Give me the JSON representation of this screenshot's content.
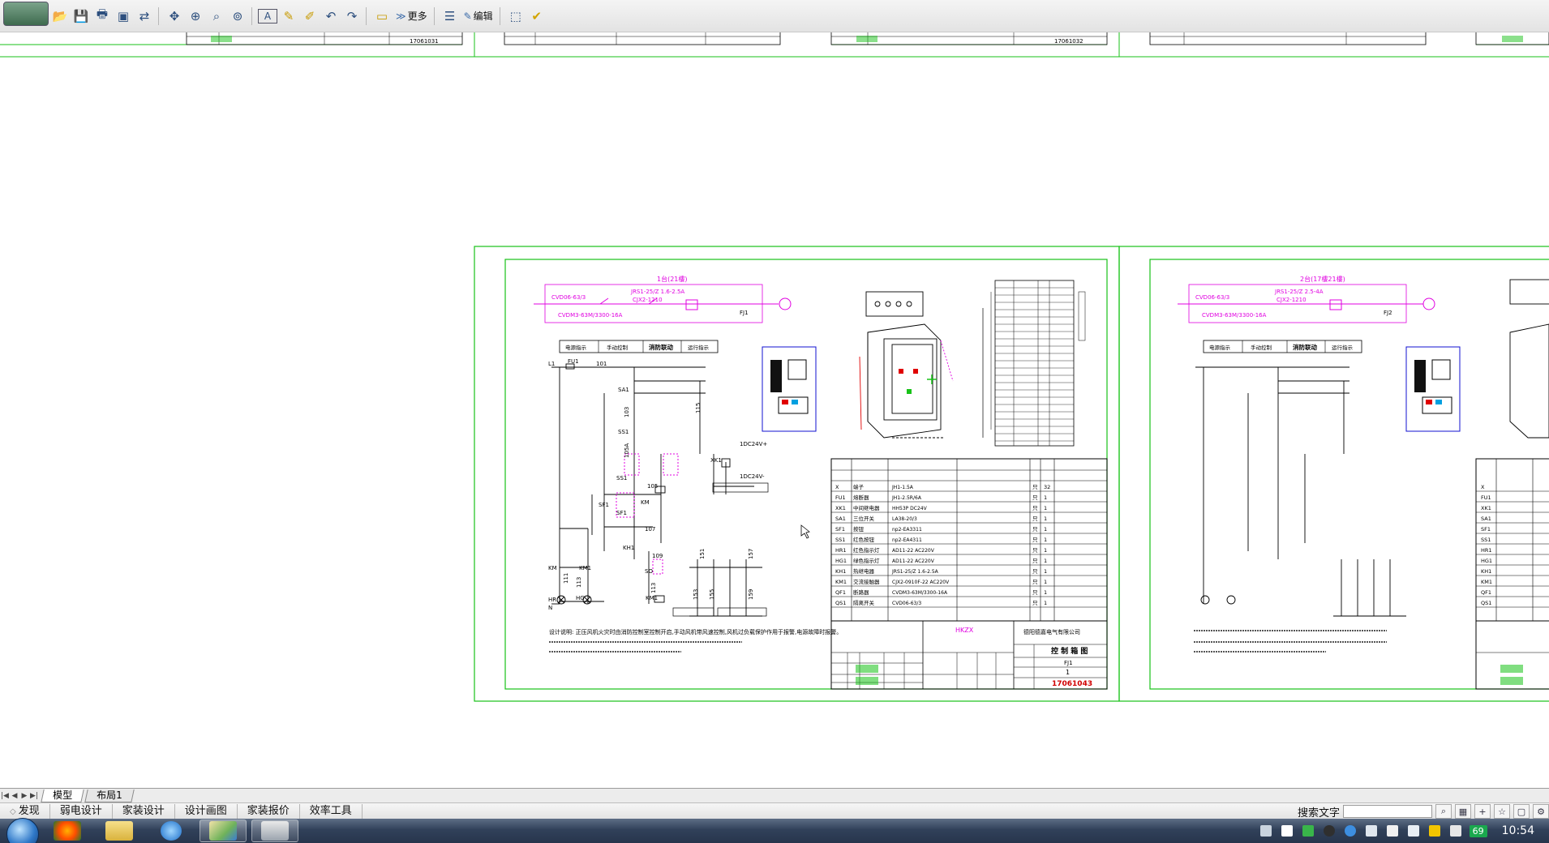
{
  "toolbar": {
    "more_label": "更多",
    "edit_label": "编辑",
    "icons": [
      "open-icon",
      "save-icon",
      "print-icon",
      "pdf-icon",
      "export-icon",
      "move-icon",
      "zoom-realtime-icon",
      "zoom-window-icon",
      "zoom-all-icon",
      "text-icon",
      "pen-icon",
      "highlight-icon",
      "undo-icon",
      "redo-icon",
      "measure-icon",
      "more-icon",
      "layers-icon",
      "edit-icon",
      "select-icon",
      "check-icon"
    ]
  },
  "drawing": {
    "top_strip": {
      "title_cells": [
        "17061031",
        "17061032"
      ]
    },
    "sheet1": {
      "header_note": "1台(21樓)",
      "feeder_labels": [
        "CVD06-63/3",
        "JRS1-25/Z 1.6-2.5A",
        "CJX2-1210",
        "CVDM3-63M/3300-16A",
        "FJ1"
      ],
      "control_headers": [
        "电源指示",
        "手动控制",
        "消防联动",
        "运行指示"
      ],
      "ladder_labels": [
        "L1",
        "FU1",
        "101",
        "SA1",
        "103",
        "SS1",
        "105A",
        "SS1",
        "SF1",
        "SF1",
        "105",
        "KM",
        "107",
        "KH1",
        "109",
        "SO",
        "113",
        "KM1",
        "115",
        "XK1",
        "1DC24V+",
        "1DC24V-",
        "KM",
        "KM1",
        "111",
        "113",
        "HR",
        "HG",
        "N",
        "151",
        "153",
        "155",
        "157",
        "159"
      ],
      "design_note": "设计说明: 正压风机火灾时由消防控制室控制开启,手动风机带风速控制,风机过负载保护作用于报警,电源故障时报警。",
      "bom": [
        {
          "code": "X",
          "name": "端子",
          "model": "JH1-1.5A",
          "unit": "只",
          "qty": "32"
        },
        {
          "code": "FU1",
          "name": "熔断器",
          "model": "JH1-2.5R/6A",
          "unit": "只",
          "qty": "1"
        },
        {
          "code": "XK1",
          "name": "中间继电器",
          "model": "HH53P DC24V",
          "unit": "只",
          "qty": "1"
        },
        {
          "code": "SA1",
          "name": "三位开关",
          "model": "LA38-20/3",
          "unit": "只",
          "qty": "1"
        },
        {
          "code": "SF1",
          "name": "按钮",
          "model": "np2-EA3311",
          "unit": "只",
          "qty": "1"
        },
        {
          "code": "SS1",
          "name": "红色按钮",
          "model": "np2-EA4311",
          "unit": "只",
          "qty": "1"
        },
        {
          "code": "HR1",
          "name": "红色指示灯",
          "model": "AD11-22 AC220V",
          "unit": "只",
          "qty": "1"
        },
        {
          "code": "HG1",
          "name": "绿色指示灯",
          "model": "AD11-22 AC220V",
          "unit": "只",
          "qty": "1"
        },
        {
          "code": "KH1",
          "name": "热继电器",
          "model": "JRS1-25/Z 1.6-2.5A",
          "unit": "只",
          "qty": "1"
        },
        {
          "code": "KM1",
          "name": "交流接触器",
          "model": "CJX2-0910F-22 AC220V",
          "unit": "只",
          "qty": "1"
        },
        {
          "code": "QF1",
          "name": "断路器",
          "model": "CVDM3-63M/3300-16A",
          "unit": "只",
          "qty": "1"
        },
        {
          "code": "QS1",
          "name": "隔离开关",
          "model": "CVD06-63/3",
          "unit": "只",
          "qty": "1"
        }
      ],
      "title_block": {
        "company": "德阳德嘉电气有限公司",
        "project": "HKZX",
        "drawing_name": "控 制 箱 图",
        "cabinet": "FJ1",
        "sheet": "1",
        "drawing_no": "17061043"
      }
    },
    "sheet2": {
      "header_note": "2台(17樓21樓)",
      "feeder_labels": [
        "CVD06-63/3",
        "JRS1-25/Z 2.5-4A",
        "CJX2-1210",
        "CVDM3-63M/3300-16A",
        "FJ2"
      ],
      "control_headers": [
        "电源指示",
        "手动控制",
        "消防联动",
        "运行指示"
      ],
      "bom_codes": [
        "X",
        "FU1",
        "XK1",
        "SA1",
        "SF1",
        "SS1",
        "HR1",
        "HG1",
        "KH1",
        "KM1",
        "QF1",
        "QS1"
      ]
    }
  },
  "layout_tabs": [
    {
      "label": "模型",
      "active": true
    },
    {
      "label": "布局1",
      "active": false
    }
  ],
  "plugin_bar": {
    "items": [
      "发现",
      "弱电设计",
      "家装设计",
      "设计画图",
      "家装报价",
      "效率工具"
    ],
    "search_label": "搜索文字",
    "search_value": ""
  },
  "taskbar": {
    "apps": [
      "ie-icon",
      "folder-icon",
      "paint-icon",
      "cad-viewer-icon"
    ],
    "tray_badge": "69",
    "clock": "10:54"
  },
  "colors": {
    "frame_green": "#18c218",
    "magenta": "#e000e0",
    "cad_black": "#000000"
  }
}
